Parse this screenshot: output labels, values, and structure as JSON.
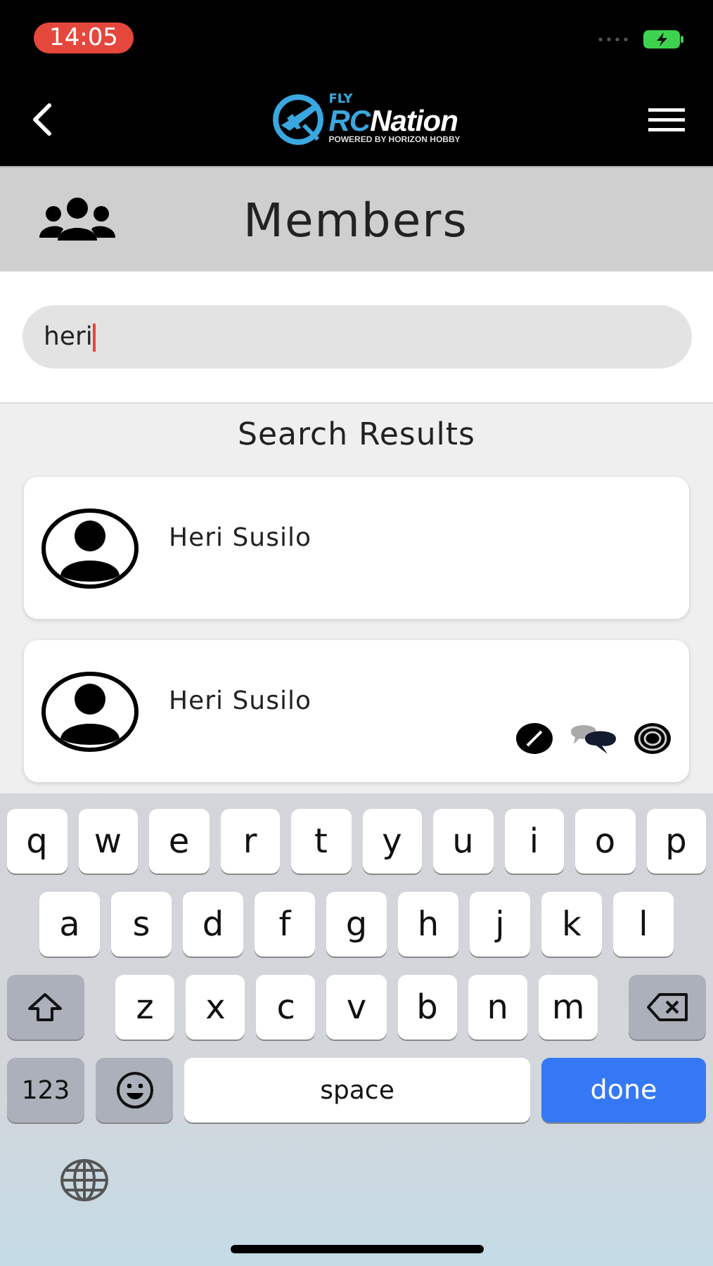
{
  "status_bar": {
    "time": "14:05"
  },
  "header": {
    "logo": {
      "top": "FLY",
      "brand_a": "RC",
      "brand_b": "Nation",
      "tagline": "POWERED BY HORIZON HOBBY"
    }
  },
  "page_title": "Members",
  "search": {
    "value": "heri"
  },
  "results_title": "Search Results",
  "results": [
    {
      "name": "Heri Susilo"
    },
    {
      "name": "Heri Susilo",
      "badges": [
        {
          "kind": "slash"
        },
        {
          "kind": "chat"
        },
        {
          "kind": "target"
        }
      ]
    }
  ],
  "keyboard": {
    "letter_rows": [
      [
        "q",
        "w",
        "e",
        "r",
        "t",
        "y",
        "u",
        "i",
        "o",
        "p"
      ],
      [
        "a",
        "s",
        "d",
        "f",
        "g",
        "h",
        "j",
        "k",
        "l"
      ],
      [
        "z",
        "x",
        "c",
        "v",
        "b",
        "n",
        "m"
      ]
    ],
    "numbers_key": "123",
    "space_key": "space",
    "done_key": "done"
  }
}
